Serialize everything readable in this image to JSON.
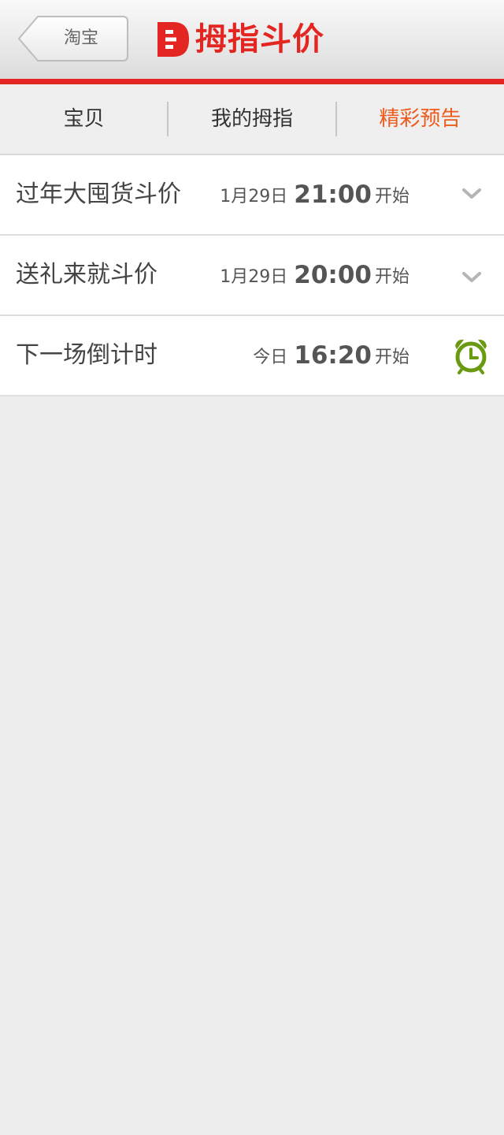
{
  "header": {
    "back_label": "淘宝",
    "brand_logo_letter": "D",
    "title": "拇指斗价"
  },
  "tabs": [
    {
      "label": "宝贝",
      "active": false
    },
    {
      "label": "我的拇指",
      "active": false
    },
    {
      "label": "精彩预告",
      "active": true
    }
  ],
  "events": [
    {
      "title": "过年大囤货斗价",
      "day": "1月29日",
      "time": "21:00",
      "suffix": "开始",
      "icon": "chevron-down-icon"
    },
    {
      "title": "送礼来就斗价",
      "day": "1月29日",
      "time": "20:00",
      "suffix": "开始",
      "icon": "chevron-down-icon"
    },
    {
      "title": "下一场倒计时",
      "day": "今日",
      "time": "16:20",
      "suffix": "开始",
      "icon": "alarm-clock-icon"
    }
  ],
  "colors": {
    "brand_red": "#e32621",
    "active_tab": "#ee5a1c",
    "alarm_green": "#6a9a12",
    "background": "#ededed"
  }
}
